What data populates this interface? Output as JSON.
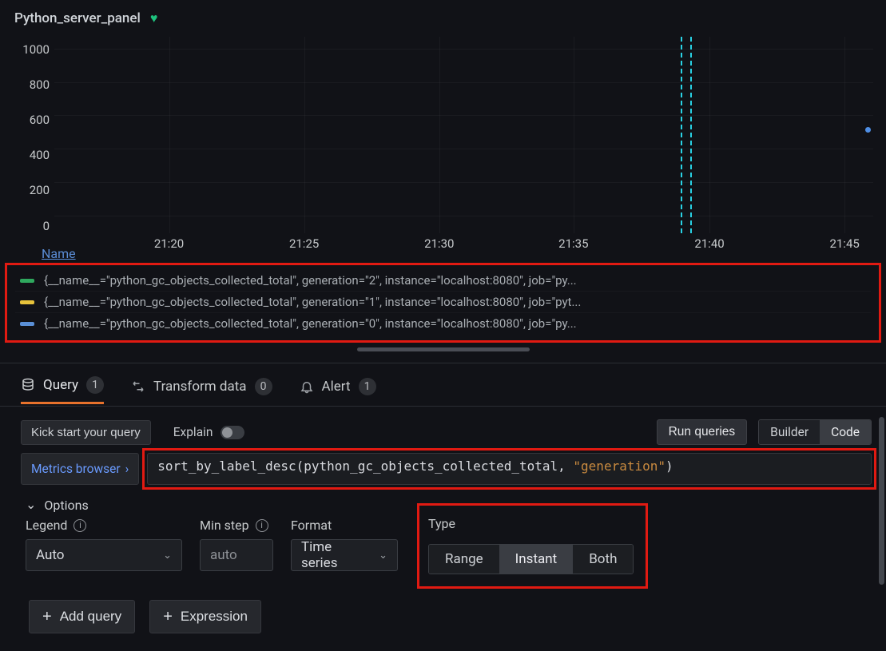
{
  "panel": {
    "title": "Python_server_panel"
  },
  "chart_data": {
    "type": "line",
    "title": "",
    "xlabel": "",
    "ylabel": "",
    "ylim": [
      0,
      1000
    ],
    "y_ticks": [
      0,
      200,
      400,
      600,
      800,
      1000
    ],
    "x_ticks": [
      "21:20",
      "21:25",
      "21:30",
      "21:35",
      "21:40",
      "21:45"
    ],
    "x_tick_positions_pct": [
      14,
      30.5,
      47,
      63.4,
      80,
      96.5
    ],
    "markers": [
      {
        "x_pct": 76.5
      },
      {
        "x_pct": 77.7
      }
    ],
    "point": {
      "x_pct": 99,
      "y_value": 540
    },
    "series": [
      {
        "name": "{__name__=\"python_gc_objects_collected_total\", generation=\"2\", instance=\"localhost:8080\", job=\"py...",
        "color": "#2fa85e"
      },
      {
        "name": "{__name__=\"python_gc_objects_collected_total\", generation=\"1\", instance=\"localhost:8080\", job=\"pyt...",
        "color": "#e7c23b"
      },
      {
        "name": "{__name__=\"python_gc_objects_collected_total\", generation=\"0\", instance=\"localhost:8080\", job=\"py...",
        "color": "#5a8fd6"
      }
    ]
  },
  "legend": {
    "header": "Name"
  },
  "tabs": {
    "query": {
      "label": "Query",
      "badge": "1"
    },
    "transform": {
      "label": "Transform data",
      "badge": "0"
    },
    "alert": {
      "label": "Alert",
      "badge": "1"
    }
  },
  "toolbar": {
    "kick": "Kick start your query",
    "explain": "Explain",
    "run": "Run queries",
    "builder": "Builder",
    "code": "Code"
  },
  "query": {
    "metrics_browser": "Metrics browser",
    "text_prefix": "sort_by_label_desc(python_gc_objects_collected_total, ",
    "text_string": "\"generation\"",
    "text_suffix": ")"
  },
  "options": {
    "header": "Options",
    "legend": {
      "label": "Legend",
      "value": "Auto"
    },
    "minstep": {
      "label": "Min step",
      "placeholder": "auto"
    },
    "format": {
      "label": "Format",
      "value": "Time series"
    },
    "type": {
      "label": "Type",
      "range": "Range",
      "instant": "Instant",
      "both": "Both",
      "selected": "Instant"
    }
  },
  "footer": {
    "add_query": "Add query",
    "expression": "Expression"
  }
}
